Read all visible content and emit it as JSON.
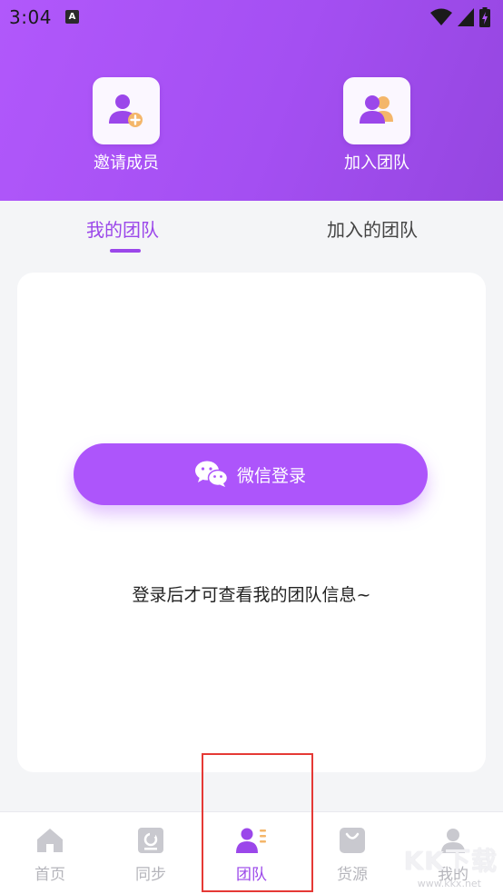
{
  "status": {
    "time": "3:04",
    "app_badge": "A"
  },
  "header": {
    "invite": {
      "label": "邀请成员",
      "icon": "add-member-icon"
    },
    "join": {
      "label": "加入团队",
      "icon": "team-members-icon"
    }
  },
  "tabs": {
    "my_team": "我的团队",
    "joined_teams": "加入的团队",
    "active": "my_team"
  },
  "content": {
    "login_button": "微信登录",
    "hint": "登录后才可查看我的团队信息~"
  },
  "bottom_nav": [
    {
      "label": "首页",
      "icon": "home-icon"
    },
    {
      "label": "同步",
      "icon": "sync-icon"
    },
    {
      "label": "团队",
      "icon": "team-icon",
      "active": true
    },
    {
      "label": "货源",
      "icon": "bag-icon"
    },
    {
      "label": "我的",
      "icon": "profile-icon"
    }
  ],
  "watermark": {
    "text": "KK下载",
    "url": "www.kkx.net"
  },
  "colors": {
    "accent": "#9b47ea",
    "header_start": "#b158fb",
    "header_end": "#9546e0",
    "highlight": "#e53935"
  }
}
